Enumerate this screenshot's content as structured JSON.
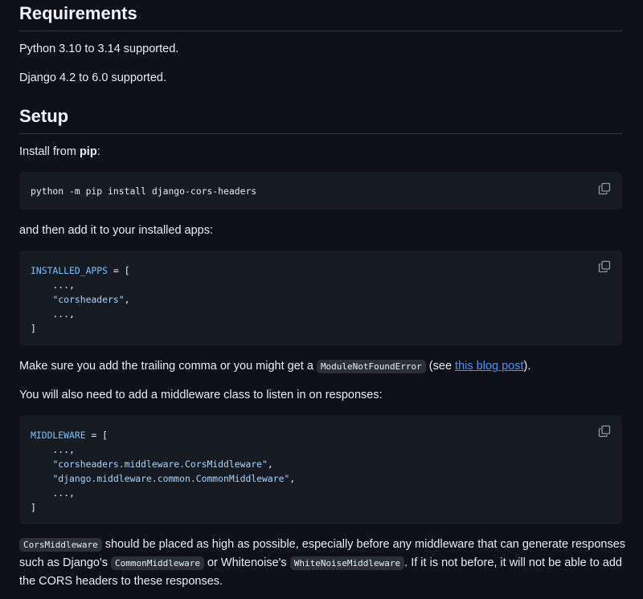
{
  "requirements": {
    "heading": "Requirements",
    "python": "Python 3.10 to 3.14 supported.",
    "django": "Django 4.2 to 6.0 supported."
  },
  "setup": {
    "heading": "Setup",
    "install_prefix": "Install from ",
    "install_bold": "pip",
    "install_suffix": ":",
    "pip_command": "python -m pip install django-cors-headers",
    "then_add": "and then add it to your installed apps:",
    "installed_apps": {
      "var": "INSTALLED_APPS",
      "op": " = [",
      "line1": "    ...,",
      "line2_indent": "    ",
      "line2_str": "\"corsheaders\"",
      "line2_tail": ",",
      "line3": "    ...,",
      "close": "]"
    },
    "trailing_prefix": "Make sure you add the trailing comma or you might get a ",
    "trailing_code": "ModuleNotFoundError",
    "trailing_mid": " (see ",
    "trailing_link": "this blog post",
    "trailing_suffix": ").",
    "middleware_intro": "You will also need to add a middleware class to listen in on responses:",
    "middleware": {
      "var": "MIDDLEWARE",
      "op": " = [",
      "line1": "    ...,",
      "line2_indent": "    ",
      "line2_str": "\"corsheaders.middleware.CorsMiddleware\"",
      "line2_tail": ",",
      "line3_indent": "    ",
      "line3_str": "\"django.middleware.common.CommonMiddleware\"",
      "line3_tail": ",",
      "line4": "    ...,",
      "close": "]"
    },
    "final": {
      "code1": "CorsMiddleware",
      "text1": " should be placed as high as possible, especially before any middleware that can generate responses such as Django's ",
      "code2": "CommonMiddleware",
      "text2": " or Whitenoise's ",
      "code3": "WhiteNoiseMiddleware",
      "text3": ". If it is not before, it will not be able to add the CORS headers to these responses."
    }
  },
  "icons": {
    "copy": "copy-icon"
  },
  "colors": {
    "background": "#0d1117",
    "code_bg": "#161b22",
    "link": "#4493f8",
    "keyword": "#79c0ff"
  }
}
